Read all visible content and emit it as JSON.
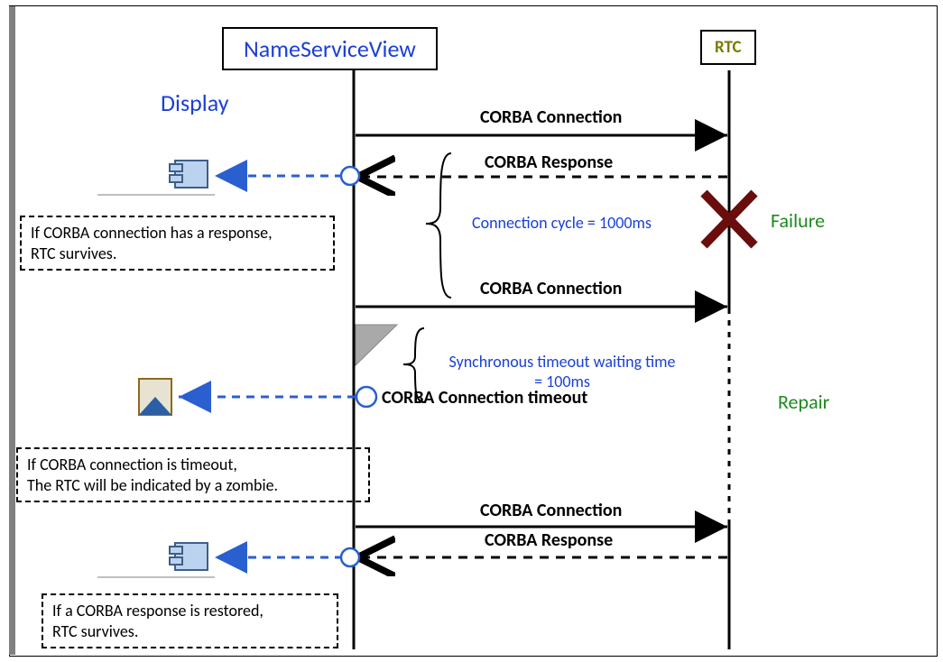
{
  "header": {
    "participant_left": "NameServiceView",
    "participant_right": "RTC",
    "display_label": "Display"
  },
  "messages": {
    "conn1": "CORBA Connection",
    "resp1": "CORBA Response",
    "conn2": "CORBA Connection",
    "timeout_label": "CORBA Connection timeout",
    "conn3": "CORBA Connection",
    "resp3": "CORBA Response"
  },
  "annotations": {
    "cycle": "Connection cycle = 1000ms",
    "sync_timeout_line1": "Synchronous timeout waiting time",
    "sync_timeout_line2": "= 100ms"
  },
  "events": {
    "failure": "Failure",
    "repair": "Repair"
  },
  "notes": {
    "survive_line1": "If CORBA connection has a response,",
    "survive_line2": "RTC survives.",
    "zombie_line1": "If CORBA connection is timeout,",
    "zombie_line2": "The RTC will be indicated by a zombie.",
    "restored_line1": "If a CORBA response is restored,",
    "restored_line2": "RTC survives."
  }
}
